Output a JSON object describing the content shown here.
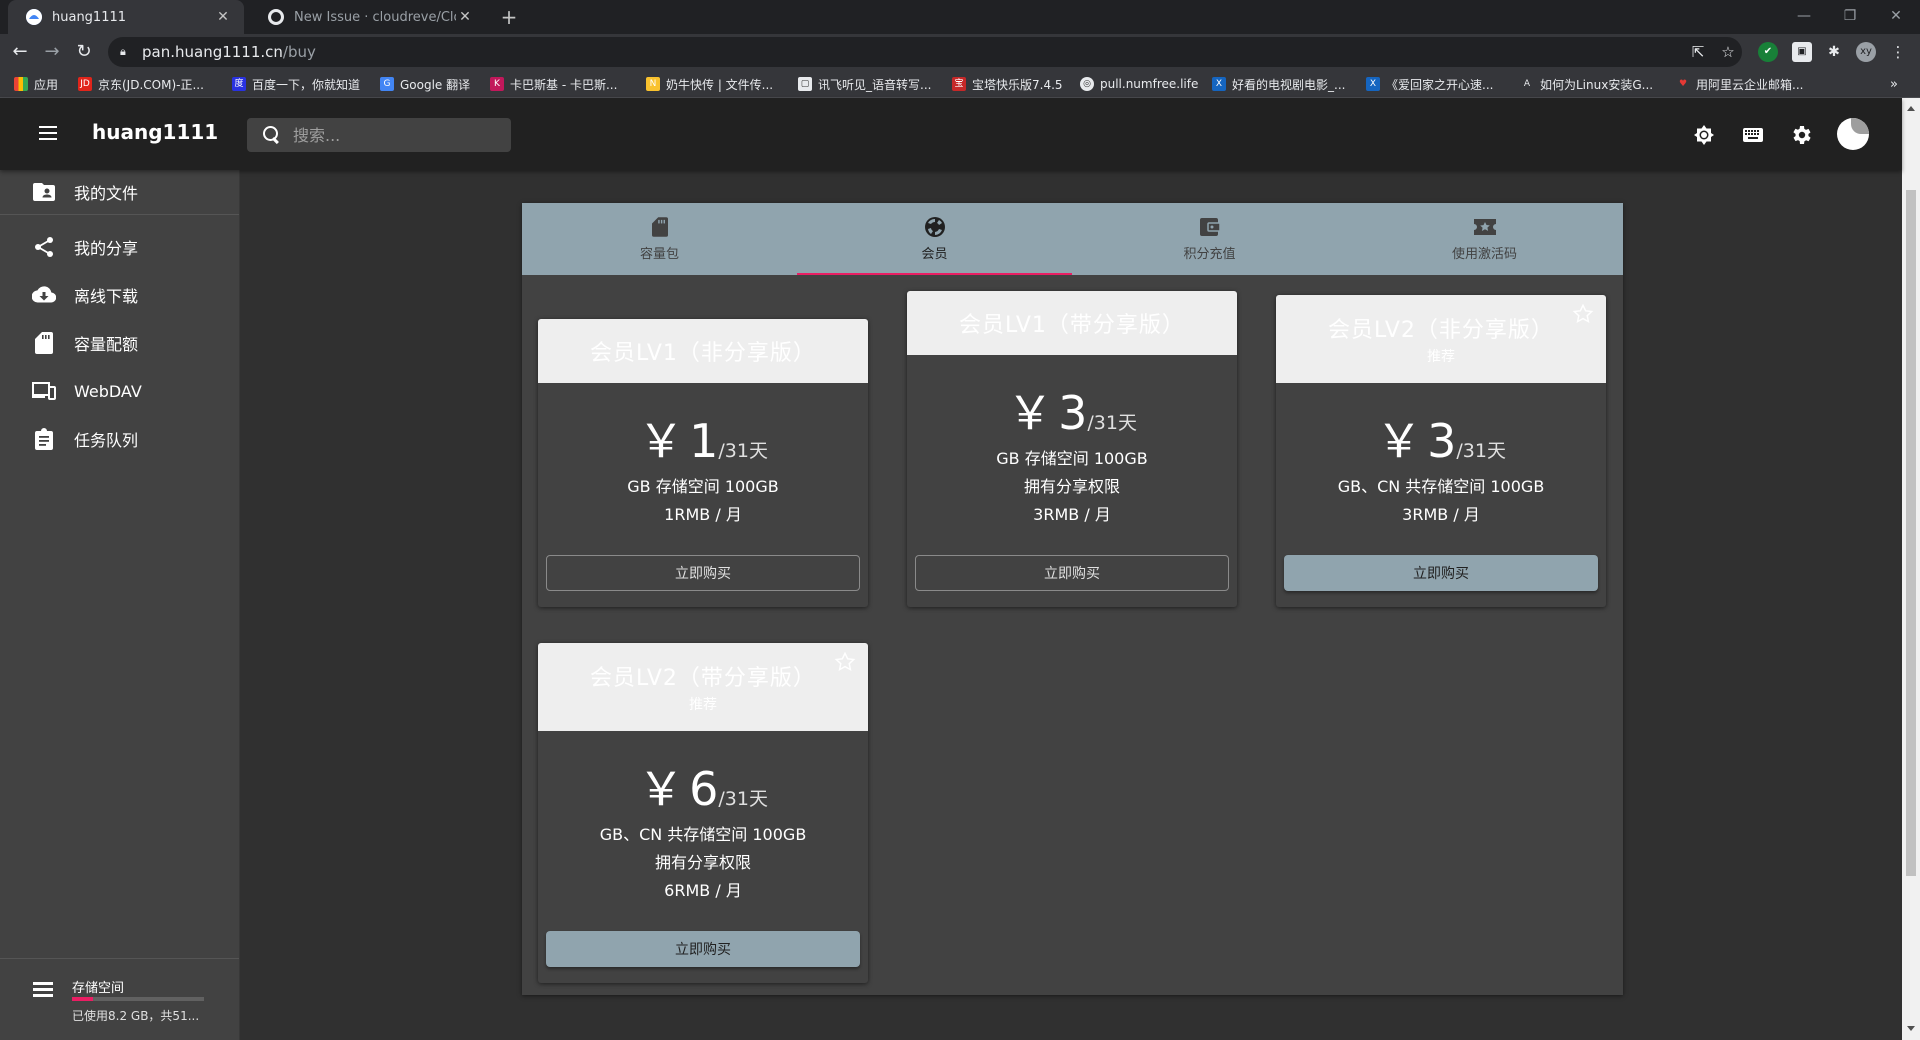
{
  "browser": {
    "tabs": [
      {
        "title": "huang1111",
        "active": true
      },
      {
        "title": "New Issue · cloudreve/Cloudre",
        "active": false
      }
    ],
    "url_host": "pan.huang1111.cn",
    "url_path": "/buy",
    "profile_initials": "xy",
    "bookmarks": [
      "应用",
      "京东(JD.COM)-正...",
      "百度一下，你就知道",
      "Google 翻译",
      "卡巴斯基 - 卡巴斯...",
      "奶牛快传 | 文件传...",
      "讯飞听见_语音转写...",
      "宝塔快乐版7.4.5",
      "pull.numfree.life",
      "好看的电视剧电影_...",
      "《爱回家之开心速...",
      "如何为Linux安装G...",
      "用阿里云企业邮箱..."
    ]
  },
  "app": {
    "title": "huang1111",
    "search_placeholder": "搜索...",
    "accent": "#e91e63",
    "primary": "#90a4ae"
  },
  "sidebar": {
    "items": [
      {
        "label": "我的文件",
        "icon": "folder-account-icon"
      },
      {
        "label": "我的分享",
        "icon": "share-icon"
      },
      {
        "label": "离线下载",
        "icon": "cloud-download-icon"
      },
      {
        "label": "容量配额",
        "icon": "sd-card-icon"
      },
      {
        "label": "WebDAV",
        "icon": "devices-icon"
      },
      {
        "label": "任务队列",
        "icon": "clipboard-icon"
      }
    ],
    "storage": {
      "title": "存储空间",
      "desc": "已使用8.2 GB，共51...",
      "used_fraction": 0.16
    }
  },
  "shop": {
    "tabs": [
      {
        "label": "容量包",
        "icon": "sd-card-icon",
        "active": false
      },
      {
        "label": "会员",
        "icon": "vip-icon",
        "active": true
      },
      {
        "label": "积分充值",
        "icon": "wallet-icon",
        "active": false
      },
      {
        "label": "使用激活码",
        "icon": "ticket-icon",
        "active": false
      }
    ],
    "plans": [
      {
        "title": "会员LV1（非分享版）",
        "subtitle": "",
        "currency": "￥",
        "price": "1",
        "unit": "/31天",
        "features": [
          "GB 存储空间 100GB",
          "1RMB / 月"
        ],
        "button": "立即购买",
        "highlight": false
      },
      {
        "title": "会员LV1（带分享版）",
        "subtitle": "",
        "currency": "￥",
        "price": "3",
        "unit": "/31天",
        "features": [
          "GB 存储空间 100GB",
          "拥有分享权限",
          "3RMB / 月"
        ],
        "button": "立即购买",
        "highlight": false
      },
      {
        "title": "会员LV2（非分享版）",
        "subtitle": "推荐",
        "currency": "￥",
        "price": "3",
        "unit": "/31天",
        "features": [
          "GB、CN 共存储空间 100GB",
          "3RMB / 月"
        ],
        "button": "立即购买",
        "highlight": true
      },
      {
        "title": "会员LV2（带分享版）",
        "subtitle": "推荐",
        "currency": "￥",
        "price": "6",
        "unit": "/31天",
        "features": [
          "GB、CN 共存储空间 100GB",
          "拥有分享权限",
          "6RMB / 月"
        ],
        "button": "立即购买",
        "highlight": true
      }
    ]
  }
}
